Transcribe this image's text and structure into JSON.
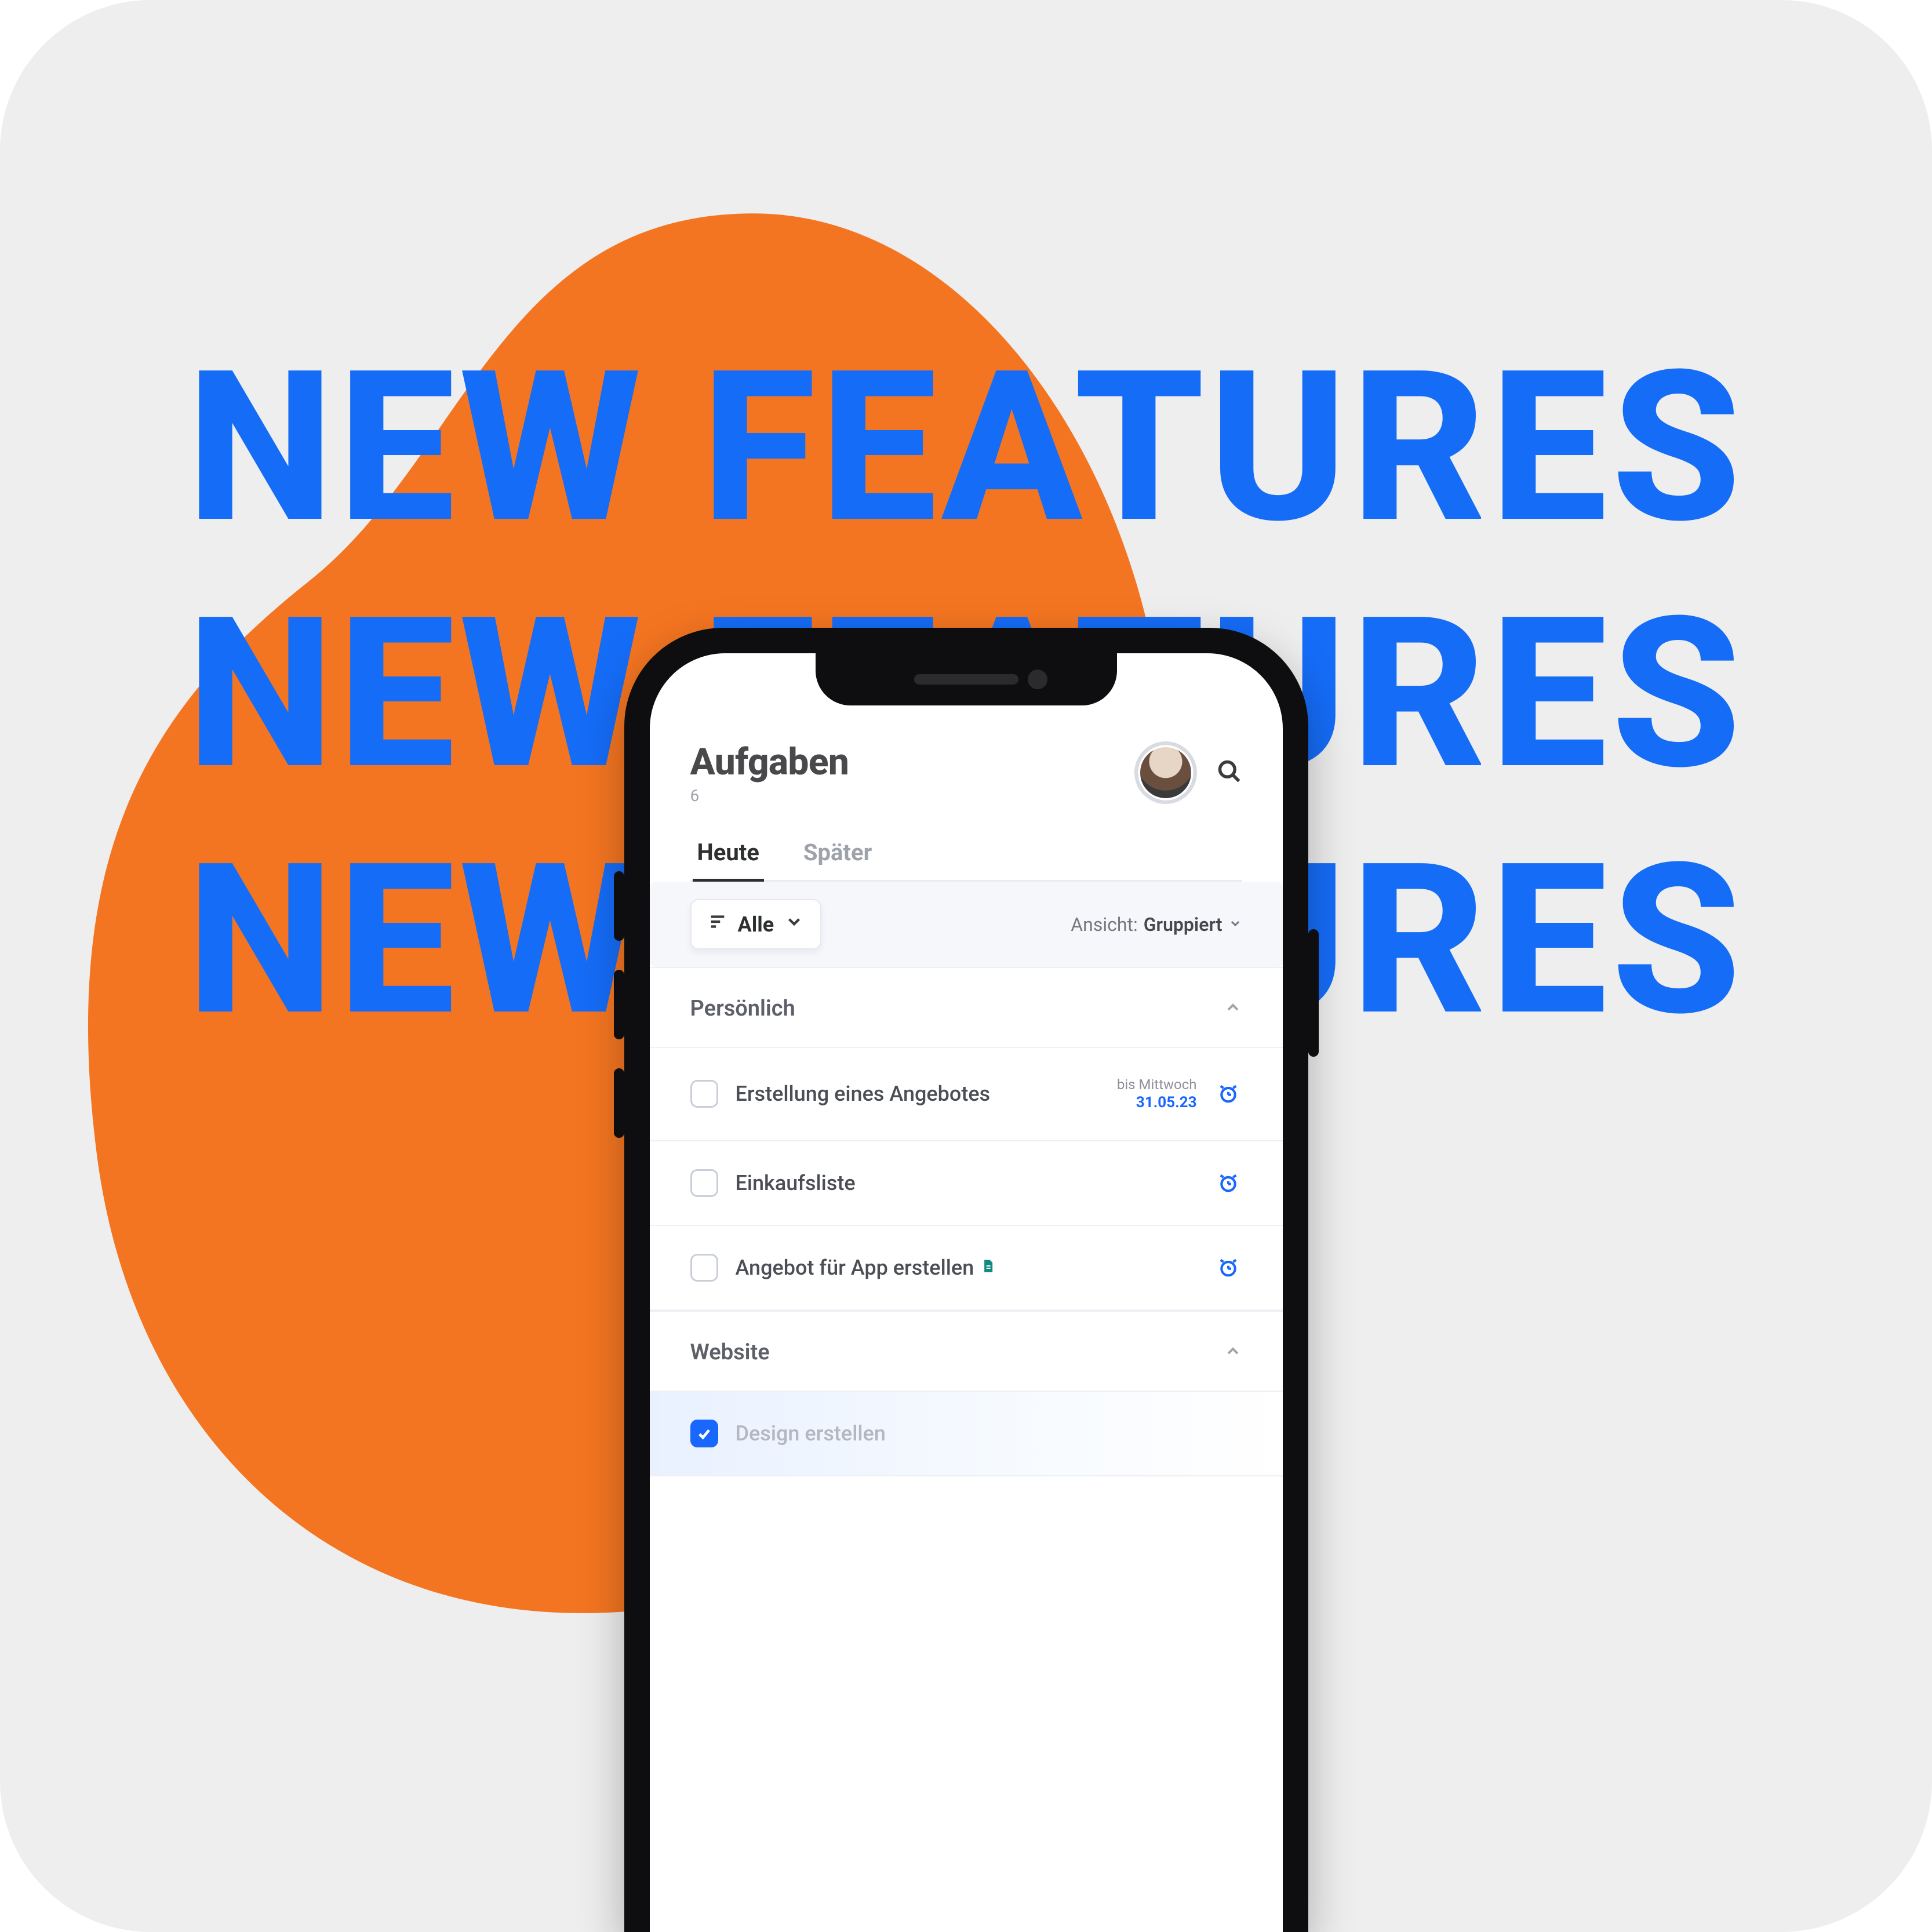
{
  "hero": {
    "line": "NEW FEATURES"
  },
  "header": {
    "title": "Aufgaben",
    "count": "6"
  },
  "tabs": {
    "today": "Heute",
    "later": "Später"
  },
  "filter": {
    "chip_label": "Alle",
    "view_label": "Ansicht:",
    "view_value": "Gruppiert"
  },
  "sections": {
    "personal": {
      "title": "Persönlich",
      "tasks": [
        {
          "title": "Erstellung eines Angebotes",
          "due_label": "bis Mittwoch",
          "due_date": "31.05.23"
        },
        {
          "title": "Einkaufsliste"
        },
        {
          "title": "Angebot für App erstellen",
          "has_attachment": true
        }
      ]
    },
    "website": {
      "title": "Website",
      "tasks": [
        {
          "title": "Design erstellen",
          "checked": true
        }
      ]
    }
  }
}
